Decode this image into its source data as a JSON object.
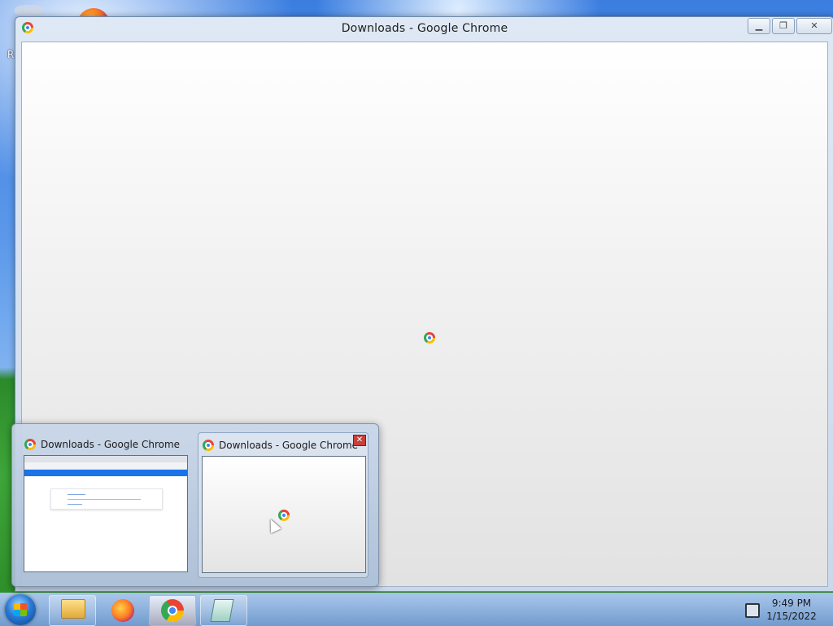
{
  "desktop": {
    "edge_text": "R"
  },
  "window": {
    "title": "Downloads - Google Chrome",
    "controls": {
      "minimize": "▁",
      "restore": "❐",
      "close": "✕"
    }
  },
  "taskbar_preview": {
    "thumbnails": [
      {
        "title": "Downloads - Google Chrome"
      },
      {
        "title": "Downloads - Google Chrome",
        "close_label": "✕"
      }
    ]
  },
  "taskbar": {
    "apps": [
      "file-explorer-icon",
      "firefox-icon",
      "chrome-icon",
      "notepad-icon"
    ],
    "clock": {
      "time": "9:49 PM",
      "date": "1/15/2022"
    }
  }
}
